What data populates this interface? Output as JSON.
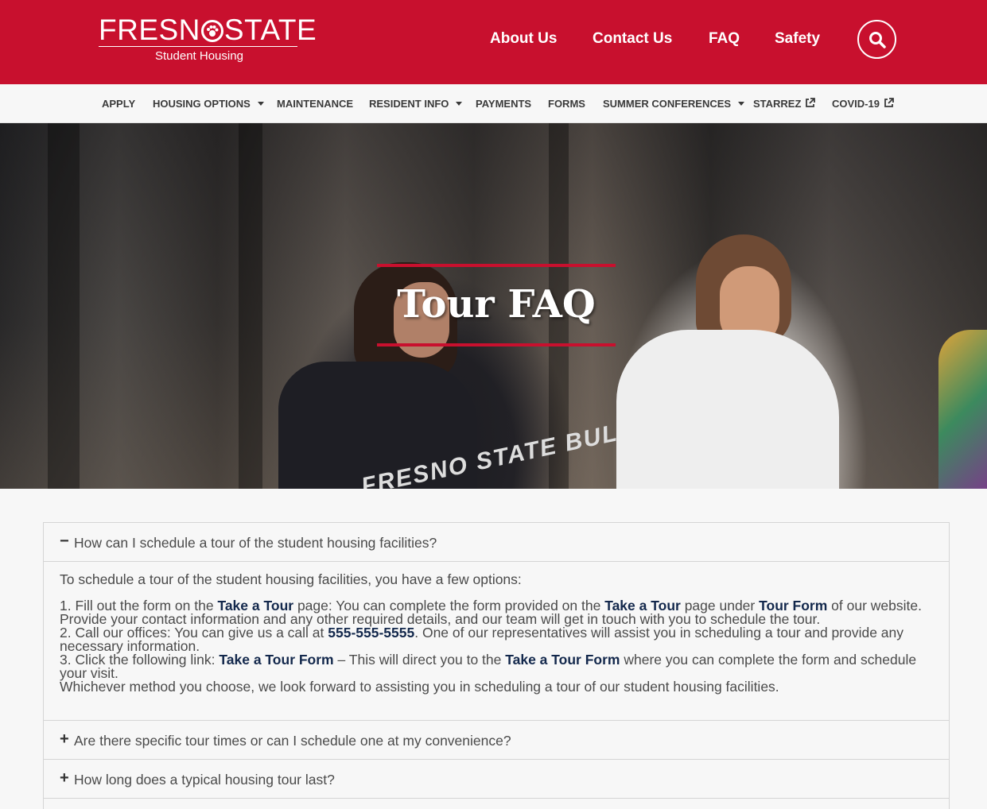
{
  "header": {
    "logo_text_left": "FRESN",
    "logo_text_right": "STATE",
    "logo_subtitle": "Student Housing",
    "links": [
      "About Us",
      "Contact Us",
      "FAQ",
      "Safety"
    ],
    "brand_color": "#c8102e"
  },
  "nav": {
    "items": [
      {
        "label": "APPLY"
      },
      {
        "label": "HOUSING OPTIONS"
      },
      {
        "label": "MAINTENANCE"
      },
      {
        "label": "RESIDENT INFO"
      },
      {
        "label": "PAYMENTS"
      },
      {
        "label": "FORMS"
      },
      {
        "label": "SUMMER CONFERENCES"
      },
      {
        "label": "STARREZ"
      },
      {
        "label": "COVID-19"
      }
    ]
  },
  "hero": {
    "title": "Tour FAQ",
    "shirt_print": "FRESNO STATE BULLDOGS"
  },
  "faq": {
    "items": [
      {
        "icon": "−",
        "question": "How can I schedule a tour of the student housing facilities?"
      },
      {
        "icon": "+",
        "question": "Are there specific tour times or can I schedule one at my convenience?"
      },
      {
        "icon": "+",
        "question": "How long does a typical housing tour last?"
      }
    ],
    "answer": {
      "intro": "To schedule a tour of the student housing facilities, you have a few options:",
      "l1_a": "1. Fill out the form on the ",
      "l1_link1": "Take a Tour",
      "l1_b": " page: You can complete the form provided on the ",
      "l1_link2": "Take a Tour",
      "l1_c": " page under ",
      "l1_link3": "Tour Form",
      "l1_d": " of our website.",
      "l2": "Provide your contact information and any other required details, and our team will get in touch with you to schedule the tour.",
      "l3_a": "2. Call our offices: You can give us a call at ",
      "l3_phone": "555-555-5555",
      "l3_b": ". One of our representatives will assist you in scheduling a tour and provide any",
      "l4": "necessary information.",
      "l5_a": "3. Click the following link: ",
      "l5_link1": "Take a Tour Form",
      "l5_b": " – This will direct you to the ",
      "l5_link2": "Take a Tour Form",
      "l5_c": " where you can complete the form and schedule",
      "l6": "your visit.",
      "l7": "Whichever method you choose, we look forward to assisting you in scheduling a tour of our student housing facilities."
    },
    "link_color": "#13284c"
  }
}
